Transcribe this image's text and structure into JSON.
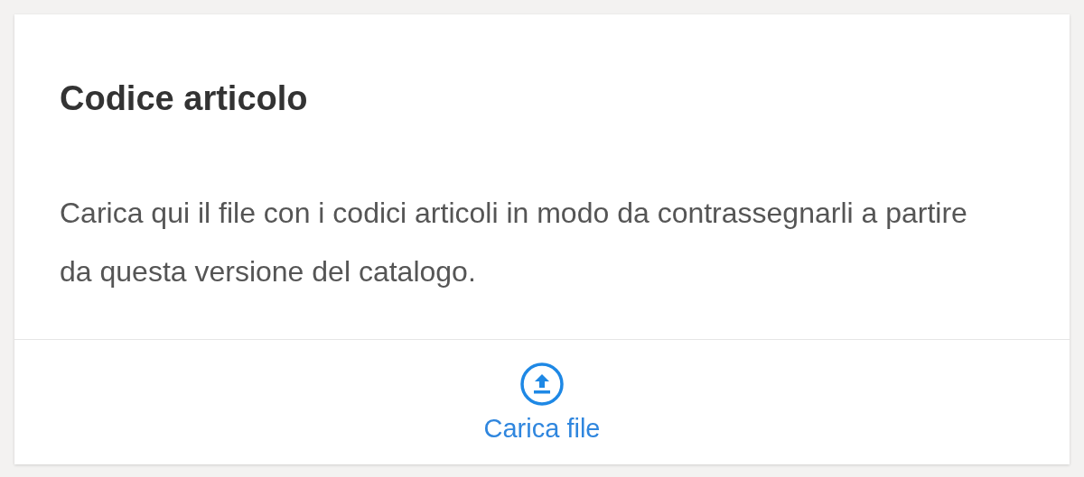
{
  "card": {
    "title": "Codice articolo",
    "description": "Carica qui il file con i codici articoli in modo da contrassegnarli a partire da questa versione del catalogo.",
    "action": {
      "label": "Carica file"
    }
  }
}
